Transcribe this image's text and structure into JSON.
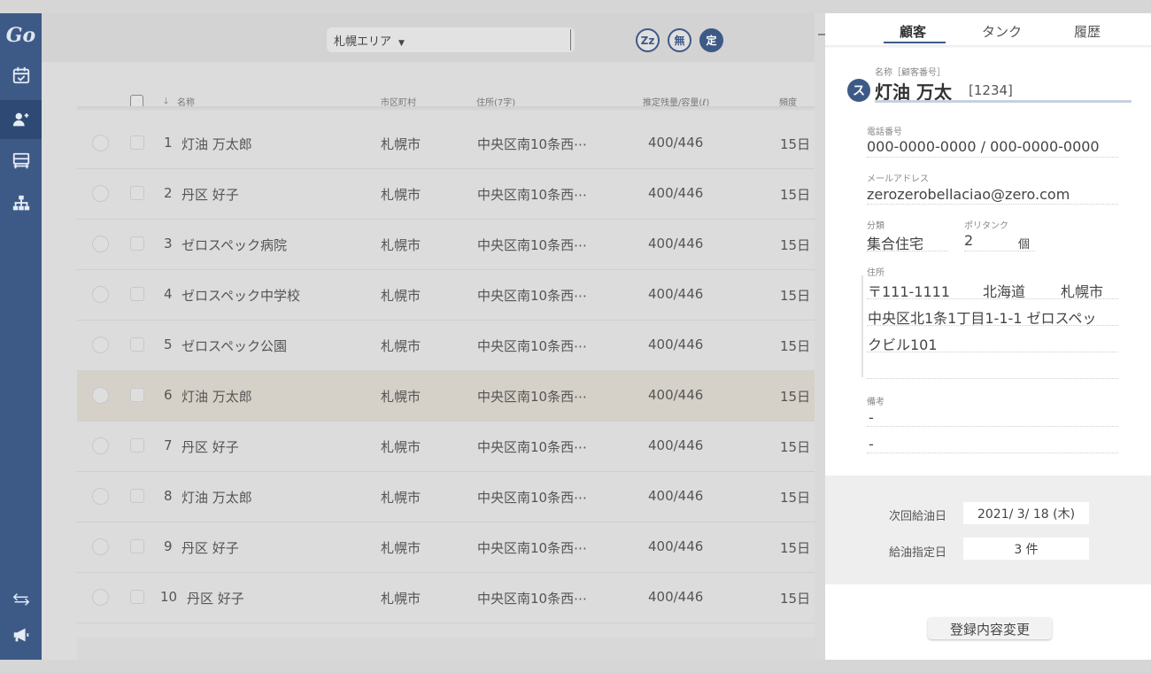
{
  "app": {
    "logo": "Go"
  },
  "sidebar": {
    "items": [
      {
        "name": "calendar-check-icon"
      },
      {
        "name": "users-icon",
        "active": true
      },
      {
        "name": "truck-icon"
      },
      {
        "name": "org-chart-icon"
      },
      {
        "name": "swap-arrows-icon"
      },
      {
        "name": "megaphone-icon"
      }
    ]
  },
  "toolbar": {
    "area_value": "札幌エリア",
    "flags": [
      "Zz",
      "無",
      "定"
    ]
  },
  "table": {
    "headers": {
      "name": "名称",
      "city": "市区町村",
      "address": "住所(7字)",
      "volume": "推定残量/容量(ℓ)",
      "frequency": "頻度"
    },
    "rows": [
      {
        "no": "1",
        "name": "灯油 万太郎",
        "city": "札幌市",
        "address": "中央区南10条西⋯",
        "volume": "400/446",
        "frequency": "15日"
      },
      {
        "no": "2",
        "name": "丹区 好子",
        "city": "札幌市",
        "address": "中央区南10条西⋯",
        "volume": "400/446",
        "frequency": "15日"
      },
      {
        "no": "3",
        "name": "ゼロスペック病院",
        "city": "札幌市",
        "address": "中央区南10条西⋯",
        "volume": "400/446",
        "frequency": "15日"
      },
      {
        "no": "4",
        "name": "ゼロスペック中学校",
        "city": "札幌市",
        "address": "中央区南10条西⋯",
        "volume": "400/446",
        "frequency": "15日"
      },
      {
        "no": "5",
        "name": "ゼロスペック公園",
        "city": "札幌市",
        "address": "中央区南10条西⋯",
        "volume": "400/446",
        "frequency": "15日"
      },
      {
        "no": "6",
        "name": "灯油 万太郎",
        "city": "札幌市",
        "address": "中央区南10条西⋯",
        "volume": "400/446",
        "frequency": "15日",
        "highlight": true
      },
      {
        "no": "7",
        "name": "丹区 好子",
        "city": "札幌市",
        "address": "中央区南10条西⋯",
        "volume": "400/446",
        "frequency": "15日"
      },
      {
        "no": "8",
        "name": "灯油 万太郎",
        "city": "札幌市",
        "address": "中央区南10条西⋯",
        "volume": "400/446",
        "frequency": "15日"
      },
      {
        "no": "9",
        "name": "丹区 好子",
        "city": "札幌市",
        "address": "中央区南10条西⋯",
        "volume": "400/446",
        "frequency": "15日"
      },
      {
        "no": "10",
        "name": "丹区 好子",
        "city": "札幌市",
        "address": "中央区南10条西⋯",
        "volume": "400/446",
        "frequency": "15日"
      }
    ]
  },
  "panel": {
    "tabs": [
      "顧客",
      "タンク",
      "履歴"
    ],
    "name_label": "名称［顧客番号］",
    "name_badge": "ス",
    "name": "灯油 万太",
    "customer_id": "[1234]",
    "phone_label": "電話番号",
    "phone": "000-0000-0000 / 000-0000-0000",
    "email_label": "メールアドレス",
    "email": "zerozerobellaciao@zero.com",
    "category_label": "分類",
    "category": "集合住宅",
    "polytank_label": "ポリタンク",
    "polytank_count": "2",
    "polytank_unit": "個",
    "address_label": "住所",
    "address_postal": "〒111-1111",
    "address_pref": "北海道",
    "address_city": "札幌市",
    "address_line1": "中央区北1条1丁目1-1-1 ゼロスペッ",
    "address_line2": "クビル101",
    "notes_label": "備考",
    "notes_line1": "-",
    "notes_line2": "-",
    "next_refuel_label": "次回給油日",
    "next_refuel_value": "2021/ 3/ 18 (木)",
    "refuel_days_label": "給油指定日",
    "refuel_days_value": "3 件",
    "edit_button": "登録内容変更"
  }
}
